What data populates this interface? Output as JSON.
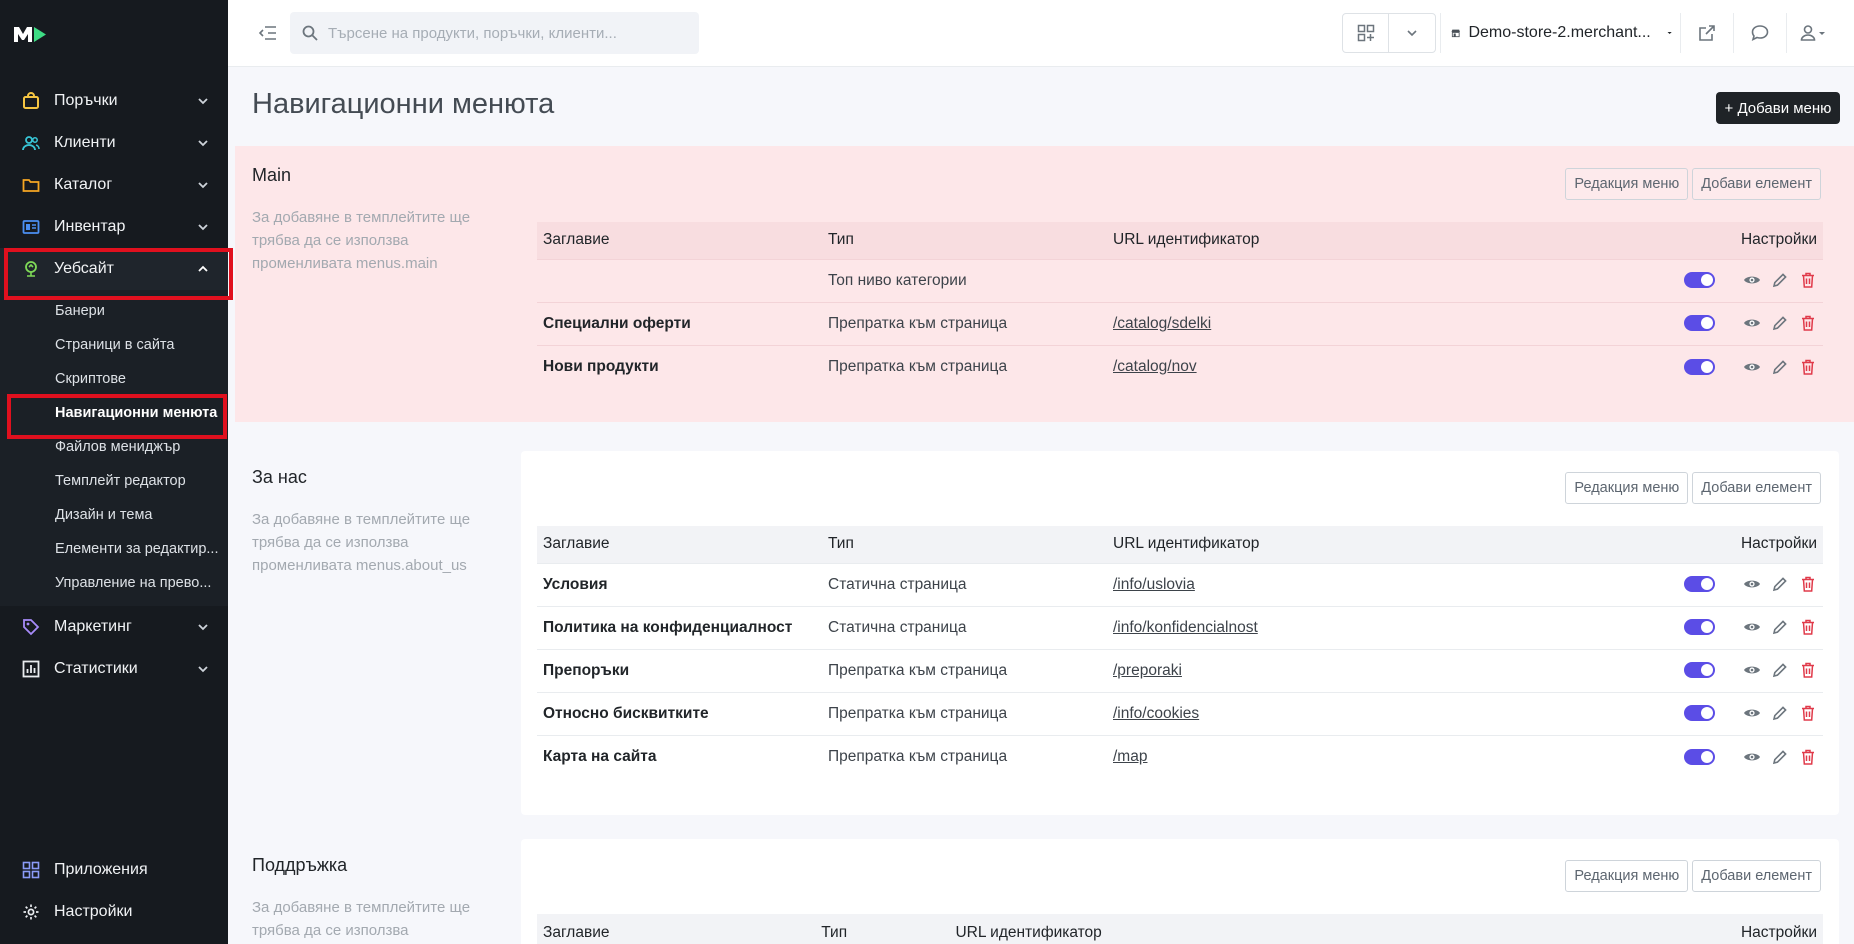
{
  "sidebar": {
    "nav": [
      {
        "label": "Поръчки",
        "icon": "shopping-bag-icon",
        "color": "#f5c542"
      },
      {
        "label": "Клиенти",
        "icon": "users-icon",
        "color": "#38c5d6"
      },
      {
        "label": "Каталог",
        "icon": "folder-icon",
        "color": "#f5a623"
      },
      {
        "label": "Инвентар",
        "icon": "inventory-icon",
        "color": "#4b8ff2"
      },
      {
        "label": "Уебсайт",
        "icon": "website-icon",
        "color": "#7ed957"
      }
    ],
    "website_sub": [
      "Банери",
      "Страници в сайта",
      "Скриптове",
      "Навигационни менюта",
      "Файлов мениджър",
      "Темплейт редактор",
      "Дизайн и тема",
      "Елементи за редактир...",
      "Управление на прево..."
    ],
    "nav_after": [
      {
        "label": "Маркетинг",
        "icon": "tag-icon",
        "color": "#a78bfa"
      },
      {
        "label": "Статистики",
        "icon": "chart-icon",
        "color": "#e9ecef"
      }
    ],
    "bottom": [
      {
        "label": "Приложения",
        "icon": "apps-icon",
        "color": "#8b9cf7"
      },
      {
        "label": "Настройки",
        "icon": "gear-icon",
        "color": "#e9ecef"
      }
    ]
  },
  "topbar": {
    "search_placeholder": "Търсене на продукти, поръчки, клиенти...",
    "store_name": "Demo-store-2.merchant..."
  },
  "page": {
    "title": "Навигационни менюта",
    "add_menu_label": "+ Добави меню"
  },
  "buttons": {
    "edit_menu": "Редакция меню",
    "add_element": "Добави елемент"
  },
  "columns": {
    "title": "Заглавие",
    "type": "Тип",
    "url": "URL идентификатор",
    "settings": "Настройки"
  },
  "menus": [
    {
      "name": "Main",
      "description": "За добавяне в темплейтите ще трябва да се използва променливата menus.main",
      "rows": [
        {
          "title": "",
          "type": "Топ ниво категории",
          "url": ""
        },
        {
          "title": "Специални оферти",
          "type": "Препратка към страница",
          "url": "/catalog/sdelki"
        },
        {
          "title": "Нови продукти",
          "type": "Препратка към страница",
          "url": "/catalog/nov"
        }
      ]
    },
    {
      "name": "За нас",
      "description": "За добавяне в темплейтите ще трябва да се използва променливата menus.about_us",
      "rows": [
        {
          "title": "Условия",
          "type": "Статична страница",
          "url": "/info/uslovia"
        },
        {
          "title": "Политика на конфиденциалност",
          "type": "Статична страница",
          "url": "/info/konfidencialnost"
        },
        {
          "title": "Препоръки",
          "type": "Препратка към страница",
          "url": "/preporaki"
        },
        {
          "title": "Относно бисквитките",
          "type": "Препратка към страница",
          "url": "/info/cookies"
        },
        {
          "title": "Карта на сайта",
          "type": "Препратка към страница",
          "url": "/map"
        }
      ]
    },
    {
      "name": "Поддръжка",
      "description": "За добавяне в темплейтите ще трябва да се използва",
      "rows": []
    }
  ],
  "colors": {
    "accent_toggle": "#5b4de6",
    "delete": "#e03a4a",
    "highlight": "#e0101e"
  }
}
